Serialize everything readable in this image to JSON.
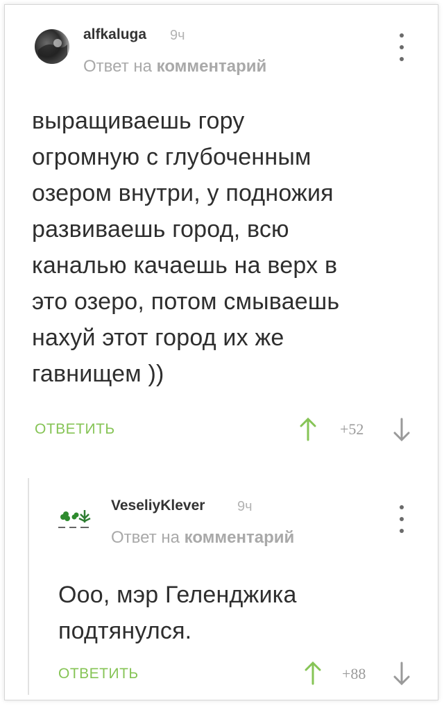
{
  "comment1": {
    "username": "alfkaluga",
    "time": "9ч",
    "reply_prefix": "Ответ на",
    "reply_target": "комментарий",
    "text": "выращиваешь гору\nогромную с глубоченным\nозером внутри, у подножия\nразвиваешь город, всю\nканалью качаешь на верх в\nэто озеро, потом смываешь\nнахуй этот город их же\nгавнищем ))",
    "reply_label": "ОТВЕТИТЬ",
    "score": "+52"
  },
  "comment2": {
    "username": "VeseliyKlever",
    "time": "9ч",
    "reply_prefix": "Ответ на",
    "reply_target": "комментарий",
    "text": "Ооо, мэр Геленджика\nподтянулся.",
    "reply_label": "ОТВЕТИТЬ",
    "score": "+88"
  },
  "colors": {
    "accent_green": "#86c456",
    "text": "#2e2e2e",
    "muted": "#a9a9a9"
  }
}
